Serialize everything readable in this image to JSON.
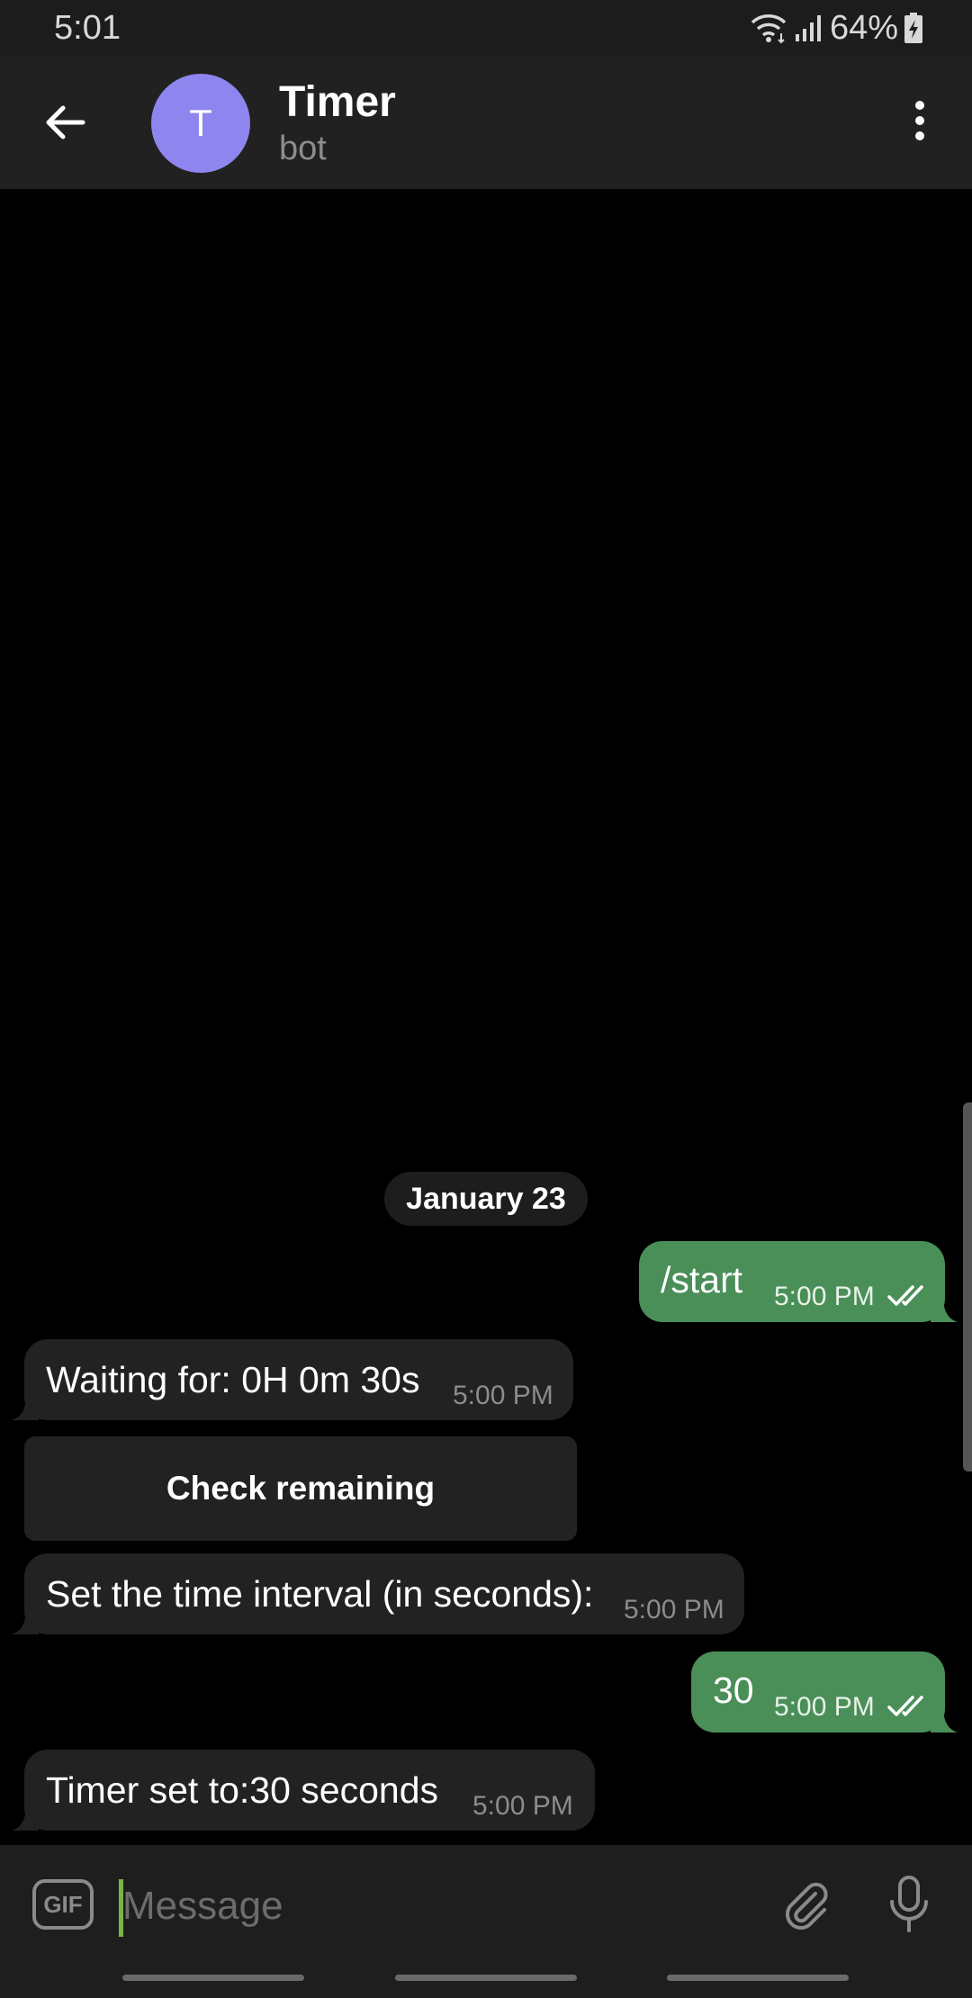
{
  "status_bar": {
    "time": "5:01",
    "battery": "64%",
    "icons": [
      "wifi-icon",
      "signal-icon",
      "battery-charging-icon"
    ]
  },
  "header": {
    "avatar_letter": "T",
    "title": "Timer",
    "subtitle": "bot",
    "icons": [
      "back-arrow-icon",
      "more-vertical-icon"
    ]
  },
  "chat": {
    "date_chip": "January 23",
    "messages": [
      {
        "direction": "out",
        "text": "/start",
        "time": "5:00 PM",
        "read": true
      },
      {
        "direction": "in",
        "text": "Waiting for: 0H 0m 30s",
        "time": "5:00 PM"
      },
      {
        "direction": "in",
        "text": "Set the time interval (in seconds):",
        "time": "5:00 PM"
      },
      {
        "direction": "out",
        "text": "30",
        "time": "5:00 PM",
        "read": true
      },
      {
        "direction": "in",
        "text": "Timer set to:30 seconds",
        "time": "5:00 PM"
      }
    ],
    "inline_button": "Check remaining"
  },
  "composer": {
    "gif_label": "GIF",
    "placeholder": "Message",
    "value": "",
    "icons": [
      "attach-icon",
      "microphone-icon"
    ]
  },
  "colors": {
    "outgoing_bubble": "#4a8e58",
    "incoming_bubble": "#222222",
    "avatar": "#8f85ee",
    "header": "#212121",
    "background": "#000000",
    "cursor": "#7cb342"
  }
}
